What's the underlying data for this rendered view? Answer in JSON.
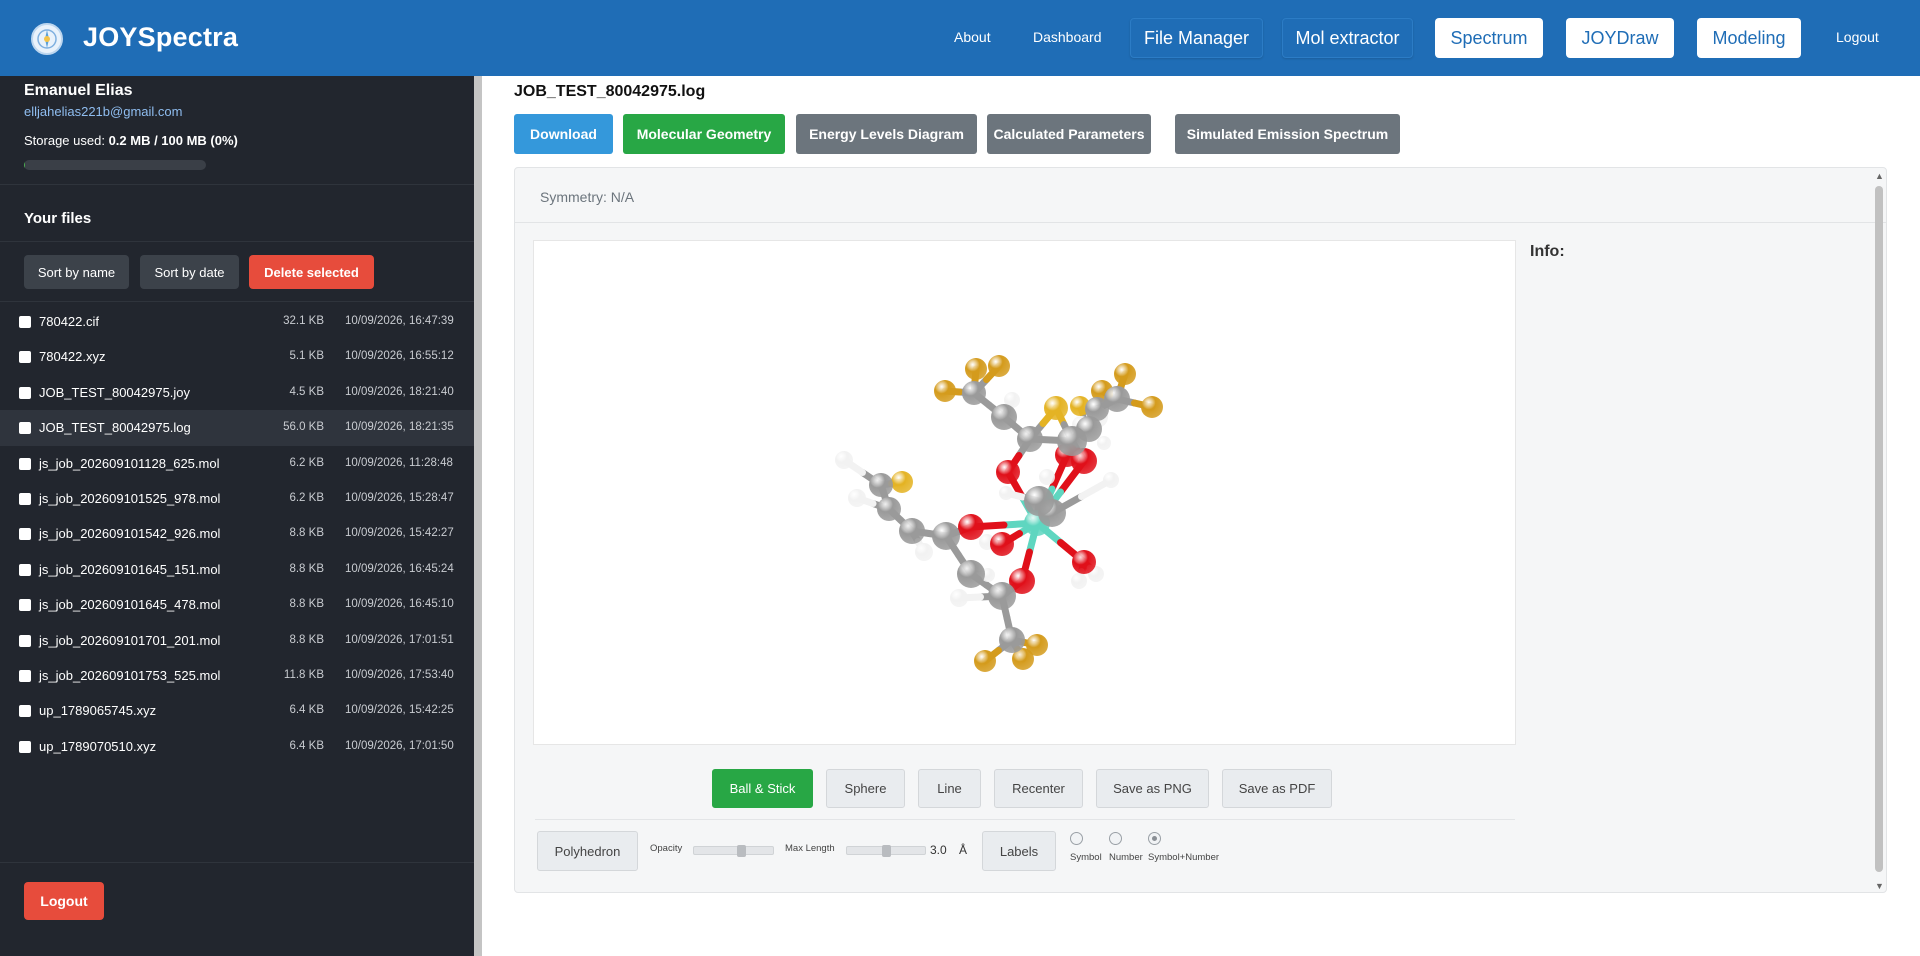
{
  "header": {
    "brand": "JOYSpectra",
    "nav_links": [
      "About",
      "Dashboard"
    ],
    "nav_pills": [
      "File Manager",
      "Mol extractor"
    ],
    "nav_buttons": [
      "Spectrum",
      "JOYDraw",
      "Modeling"
    ],
    "logout": "Logout"
  },
  "sidebar": {
    "user_name": "Emanuel Elias",
    "user_email": "elljahelias221b@gmail.com",
    "storage_label": "Storage used: ",
    "storage_value": "0.2 MB / 100 MB (0%)",
    "storage_fraction": 0.002,
    "files_title": "Your files",
    "sort_name": "Sort by name",
    "sort_date": "Sort by date",
    "delete_selected": "Delete selected",
    "files": [
      {
        "name": "780422.cif",
        "size": "32.1 KB",
        "date": "10/09/2026, 16:47:39"
      },
      {
        "name": "780422.xyz",
        "size": "5.1 KB",
        "date": "10/09/2026, 16:55:12"
      },
      {
        "name": "JOB_TEST_80042975.joy",
        "size": "4.5 KB",
        "date": "10/09/2026, 18:21:40"
      },
      {
        "name": "JOB_TEST_80042975.log",
        "size": "56.0 KB",
        "date": "10/09/2026, 18:21:35",
        "active": true
      },
      {
        "name": "js_job_202609101128_625.mol",
        "size": "6.2 KB",
        "date": "10/09/2026, 11:28:48"
      },
      {
        "name": "js_job_202609101525_978.mol",
        "size": "6.2 KB",
        "date": "10/09/2026, 15:28:47"
      },
      {
        "name": "js_job_202609101542_926.mol",
        "size": "8.8 KB",
        "date": "10/09/2026, 15:42:27"
      },
      {
        "name": "js_job_202609101645_151.mol",
        "size": "8.8 KB",
        "date": "10/09/2026, 16:45:24"
      },
      {
        "name": "js_job_202609101645_478.mol",
        "size": "8.8 KB",
        "date": "10/09/2026, 16:45:10"
      },
      {
        "name": "js_job_202609101701_201.mol",
        "size": "8.8 KB",
        "date": "10/09/2026, 17:01:51"
      },
      {
        "name": "js_job_202609101753_525.mol",
        "size": "11.8 KB",
        "date": "10/09/2026, 17:53:40"
      },
      {
        "name": "up_1789065745.xyz",
        "size": "6.4 KB",
        "date": "10/09/2026, 15:42:25"
      },
      {
        "name": "up_1789070510.xyz",
        "size": "6.4 KB",
        "date": "10/09/2026, 17:01:50"
      }
    ],
    "logout": "Logout"
  },
  "main": {
    "file_title": "JOB_TEST_80042975.log",
    "tabs": [
      "Download",
      "Molecular Geometry",
      "Energy Levels Diagram",
      "Calculated Parameters",
      "Simulated Emission Spectrum"
    ],
    "symmetry": "Symmetry: N/A",
    "info_label": "Info:",
    "view_buttons": [
      "Ball & Stick",
      "Sphere",
      "Line",
      "Recenter",
      "Save as PNG",
      "Save as PDF"
    ],
    "polyhedron": "Polyhedron",
    "opacity_label": "Opacity",
    "opacity_value": 0.62,
    "max_length_label": "Max Length",
    "max_length_value": "3.0",
    "max_length_fraction": 0.5,
    "length_unit": "Å",
    "labels_button": "Labels",
    "label_modes": [
      "Symbol",
      "Number",
      "Symbol+Number"
    ],
    "label_mode_selected": "Symbol+Number"
  },
  "colors": {
    "header_bg": "#1f6db6",
    "sidebar_bg": "#22262e",
    "primary": "#3498db",
    "success": "#28a745",
    "secondary": "#6c757d",
    "danger": "#e74c3c",
    "carbon": "#9a9a9a",
    "hydrogen": "#f2f2f2",
    "oxygen": "#e0101a",
    "sulfur": "#e4b324",
    "fluorine": "#d49b1c",
    "metal": "#5fd6c0"
  }
}
